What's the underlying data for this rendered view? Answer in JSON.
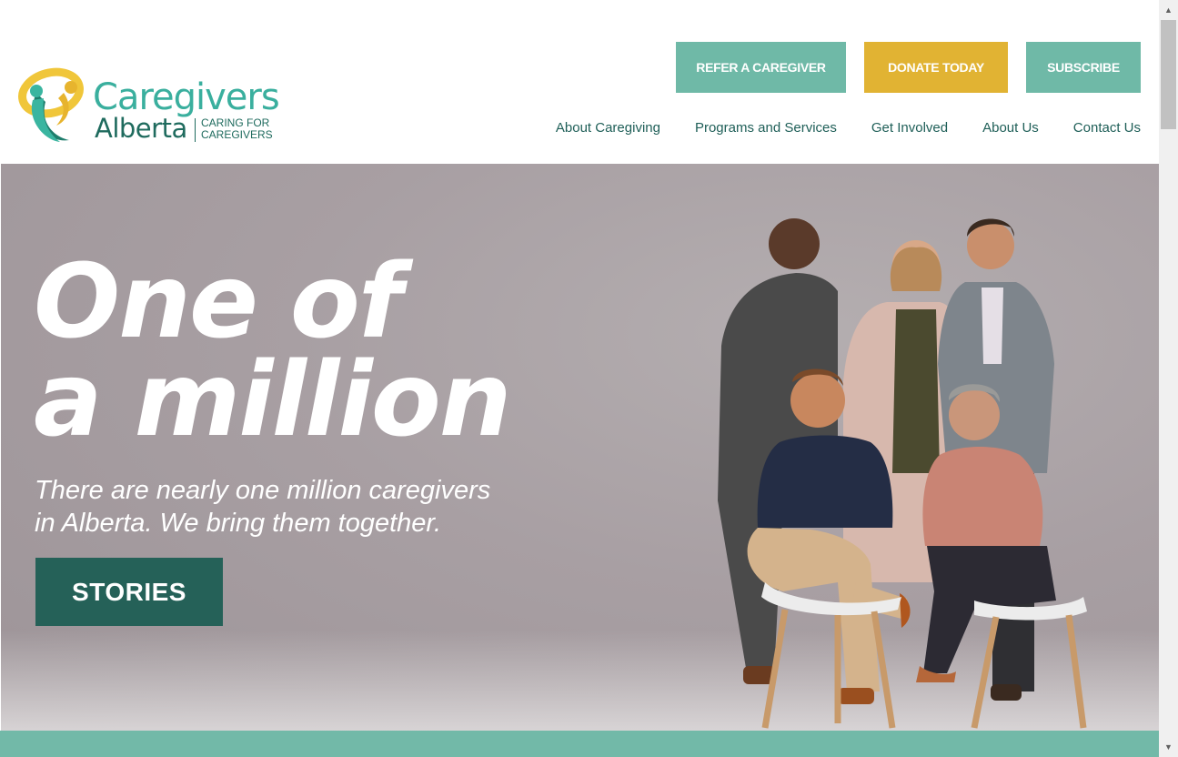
{
  "header": {
    "logo": {
      "name": "Caregivers",
      "region": "Alberta",
      "tagline_line1": "CARING FOR",
      "tagline_line2": "CAREGIVERS"
    },
    "buttons": {
      "refer": "REFER A CAREGIVER",
      "donate": "DONATE TODAY",
      "subscribe": "SUBSCRIBE"
    },
    "nav": [
      {
        "label": "About Caregiving"
      },
      {
        "label": "Programs and Services"
      },
      {
        "label": "Get Involved"
      },
      {
        "label": "About Us"
      },
      {
        "label": "Contact Us"
      }
    ]
  },
  "hero": {
    "headline_line1": "One of",
    "headline_line2": "a million",
    "subline_line1": "There are nearly one million caregivers",
    "subline_line2": "in Alberta. We bring them together.",
    "cta": "STORIES"
  },
  "colors": {
    "teal": "#6fb9a7",
    "gold": "#e1b333",
    "dark_teal": "#256158",
    "nav_text": "#1f5f58"
  },
  "icons": {
    "logo_mark": "caregivers-logo-icon",
    "scroll_up": "scroll-up-arrow-icon",
    "scroll_down": "scroll-down-arrow-icon"
  }
}
